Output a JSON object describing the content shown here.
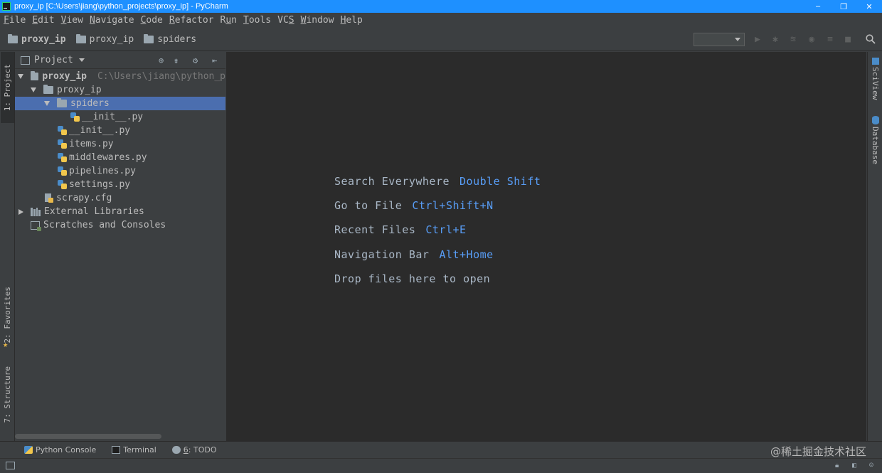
{
  "window": {
    "title": "proxy_ip [C:\\Users\\jiang\\python_projects\\proxy_ip] - PyCharm",
    "minimize": "–",
    "maximize": "❐",
    "close": "✕"
  },
  "menu": [
    {
      "label": "File",
      "mnemonic": "F",
      "rest": "ile"
    },
    {
      "label": "Edit",
      "mnemonic": "E",
      "rest": "dit"
    },
    {
      "label": "View",
      "mnemonic": "V",
      "rest": "iew"
    },
    {
      "label": "Navigate",
      "mnemonic": "N",
      "rest": "avigate"
    },
    {
      "label": "Code",
      "mnemonic": "C",
      "rest": "ode"
    },
    {
      "label": "Refactor",
      "mnemonic": "R",
      "rest": "efactor"
    },
    {
      "label": "Run",
      "pre": "R",
      "mnemonic": "u",
      "rest": "n"
    },
    {
      "label": "Tools",
      "mnemonic": "T",
      "rest": "ools"
    },
    {
      "label": "VCS",
      "pre": "VC",
      "mnemonic": "S",
      "rest": ""
    },
    {
      "label": "Window",
      "mnemonic": "W",
      "rest": "indow"
    },
    {
      "label": "Help",
      "mnemonic": "H",
      "rest": "elp"
    }
  ],
  "breadcrumbs": [
    "proxy_ip",
    "proxy_ip",
    "spiders"
  ],
  "left_tabs": {
    "project": "1: Project",
    "favorites": "2: Favorites",
    "structure": "7: Structure"
  },
  "right_tabs": {
    "sciview": "SciView",
    "database": "Database"
  },
  "project_panel": {
    "title": "Project",
    "tree": [
      {
        "label": "proxy_ip",
        "path": "C:\\Users\\jiang\\python_p",
        "icon": "folder-icon",
        "expanded": true
      },
      {
        "label": "proxy_ip",
        "icon": "folder-icon",
        "expanded": true
      },
      {
        "label": "spiders",
        "icon": "folder-icon",
        "expanded": true,
        "selected": true
      },
      {
        "label": "__init__.py",
        "icon": "python-file-icon"
      },
      {
        "label": "__init__.py",
        "icon": "python-file-icon"
      },
      {
        "label": "items.py",
        "icon": "python-file-icon"
      },
      {
        "label": "middlewares.py",
        "icon": "python-file-icon"
      },
      {
        "label": "pipelines.py",
        "icon": "python-file-icon"
      },
      {
        "label": "settings.py",
        "icon": "python-file-icon"
      },
      {
        "label": "scrapy.cfg",
        "icon": "config-file-icon"
      },
      {
        "label": "External Libraries",
        "icon": "libraries-icon",
        "expanded": false
      },
      {
        "label": "Scratches and Consoles",
        "icon": "scratches-icon"
      }
    ]
  },
  "editor": {
    "hints": [
      {
        "text": "Search Everywhere",
        "key": "Double Shift"
      },
      {
        "text": "Go to File",
        "key": "Ctrl+Shift+N"
      },
      {
        "text": "Recent Files",
        "key": "Ctrl+E"
      },
      {
        "text": "Navigation Bar",
        "key": "Alt+Home"
      },
      {
        "text": "Drop files here to open",
        "key": ""
      }
    ]
  },
  "bottom_tabs": {
    "python_console": "Python Console",
    "terminal": "Terminal",
    "todo_num": "6",
    "todo": ": TODO"
  },
  "watermark": "@稀土掘金技术社区",
  "colors": {
    "accent": "#589df6",
    "selection": "#4b6eaf",
    "titlebar": "#1e90ff",
    "editor_bg": "#2b2b2b"
  }
}
